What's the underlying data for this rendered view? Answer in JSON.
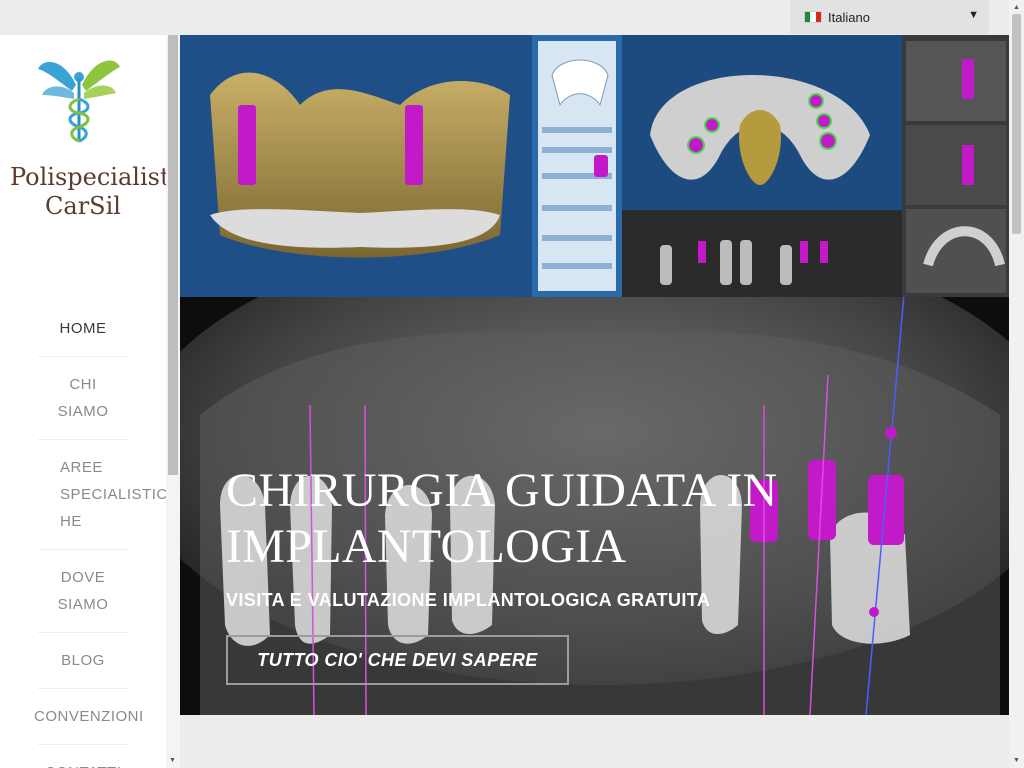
{
  "language": {
    "selected": "Italiano"
  },
  "brand": {
    "name": "Polispecialistico CarSil"
  },
  "nav": {
    "items": [
      {
        "label": "HOME",
        "active": true
      },
      {
        "label": "CHI SIAMO"
      },
      {
        "label": "AREE SPECIALISTICHE"
      },
      {
        "label": "DOVE SIAMO"
      },
      {
        "label": "BLOG"
      },
      {
        "label": "CONVENZIONI"
      },
      {
        "label": "CONTATTI"
      }
    ]
  },
  "hero": {
    "title": "CHIRURGIA GUIDATA IN IMPLANTOLOGIA",
    "subtitle": "VISITA E VALUTAZIONE IMPLANTOLOGICA GRATUITA",
    "button": "TUTTO CIO' CHE DEVI SAPERE"
  },
  "colors": {
    "brand_text": "#5a3d2e",
    "implant_magenta": "#c21ac8",
    "scan_panel_blue": "#1f4f87"
  }
}
